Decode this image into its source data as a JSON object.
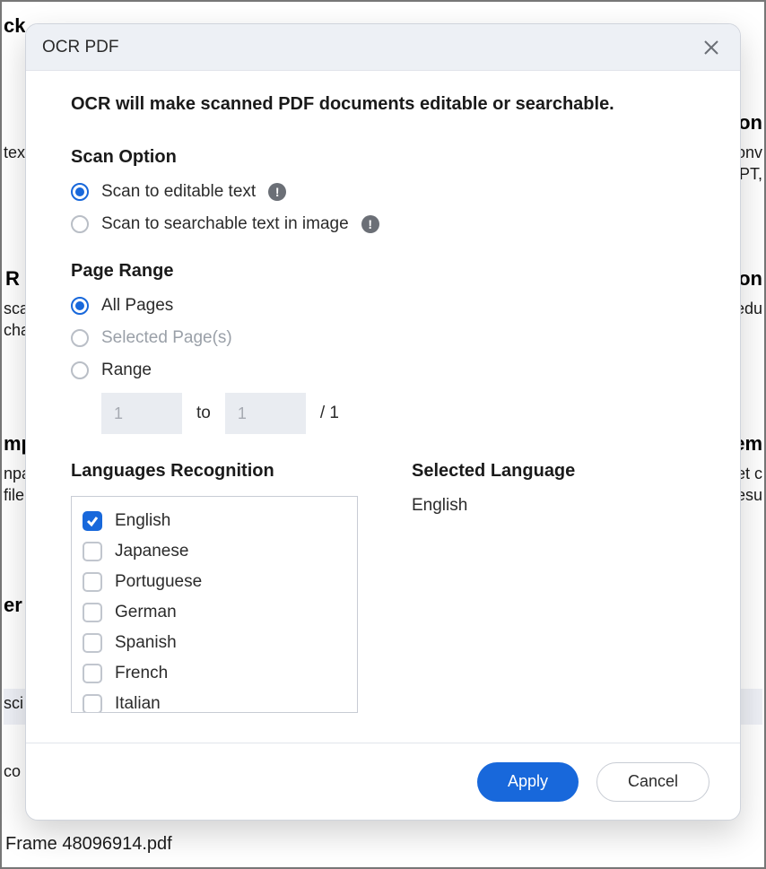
{
  "background": {
    "row1left_head": "ck",
    "row1right_head": "Con",
    "row1left_line": " tex",
    "row1right_line1": "onv",
    "row1right_line2": "PT,",
    "row2left_head": "R",
    "row2right_head": "Con",
    "row2left_line1": " sca",
    "row2left_line2": "cha",
    "row2right_line": "edu",
    "row3left_head": "mp",
    "row3right_head": "em",
    "row3left_line1": "npa",
    "row3left_line2": "file",
    "row3right_line1": "et c",
    "row3right_line2": "esu",
    "row4left_head": "er",
    "row4left_line": "sci",
    "row5left_line": "co"
  },
  "dialog": {
    "title": "OCR PDF",
    "intro": "OCR will make scanned PDF documents editable or searchable.",
    "scan": {
      "heading": "Scan Option",
      "opt1": "Scan to editable text",
      "opt2": "Scan to searchable text in image"
    },
    "page": {
      "heading": "Page Range",
      "all": "All Pages",
      "selected": "Selected Page(s)",
      "range": "Range",
      "from": "1",
      "to_label": "to",
      "to": "1",
      "total": "/ 1"
    },
    "lang": {
      "heading": "Languages Recognition",
      "selected_heading": "Selected Language",
      "selected_value": "English",
      "items": {
        "0": "English",
        "1": "Japanese",
        "2": "Portuguese",
        "3": "German",
        "4": "Spanish",
        "5": "French",
        "6": "Italian"
      }
    },
    "buttons": {
      "apply": "Apply",
      "cancel": "Cancel"
    }
  },
  "footer_file": "Frame 48096914.pdf"
}
